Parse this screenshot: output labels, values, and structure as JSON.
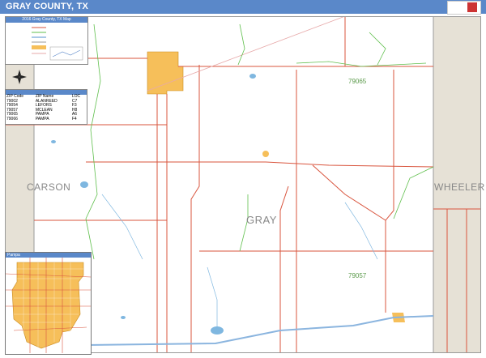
{
  "header": {
    "title": "GRAY COUNTY, TX"
  },
  "legend": {
    "title": "2016 Gray County, TX Map"
  },
  "zip_lookup": {
    "headers": [
      "ZIP Code",
      "ZIP Name",
      "LOC"
    ],
    "rows": [
      [
        "79002",
        "ALANREED",
        "C7"
      ],
      [
        "79054",
        "LEFORS",
        "F3"
      ],
      [
        "79057",
        "MCLEAN",
        "H8"
      ],
      [
        "79065",
        "PAMPA",
        "A6"
      ],
      [
        "79066",
        "PAMPA",
        "F4"
      ]
    ]
  },
  "labels": {
    "carson": "CARSON",
    "wheeler": "WHEELER",
    "gray": "GRAY",
    "zip_79065": "79065",
    "zip_79057": "79057"
  },
  "inset": {
    "title": "Pampa"
  },
  "colors": {
    "header_blue": "#5a88c9",
    "neighbor_county": "#e6e1d6",
    "city": "#f6bf5a",
    "road": "#d9553e",
    "zip_boundary": "#5fbf4c",
    "water": "#7fb7e0"
  }
}
